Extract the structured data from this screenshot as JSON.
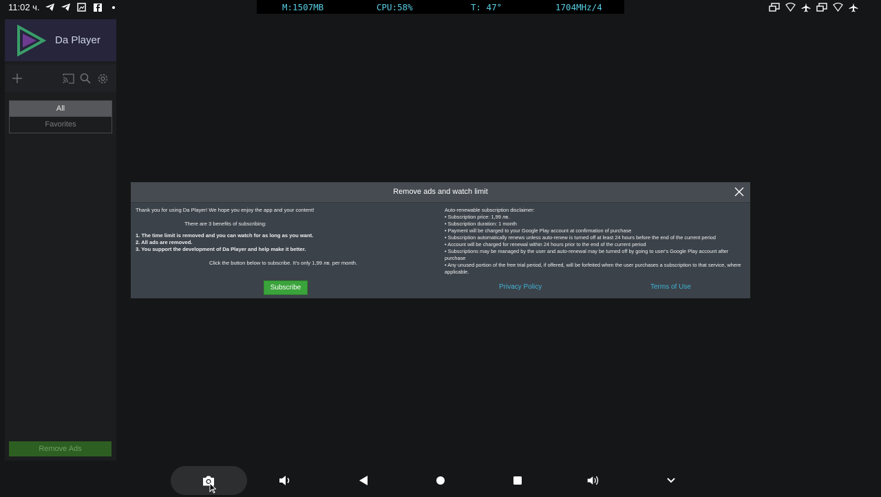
{
  "status_bar": {
    "time": "11:02 ч.",
    "memory": "M:1507MB",
    "cpu": "CPU:58%",
    "temp": "T: 47°",
    "freq": "1704MHz/4",
    "left_icons": [
      "telegram-icon",
      "telegram-icon",
      "screenshot-icon",
      "facebook-icon",
      "dot-icon"
    ],
    "right_icons": [
      "display-icon",
      "wifi-icon",
      "airplane-icon",
      "display-icon",
      "wifi-icon",
      "airplane-icon"
    ]
  },
  "sidebar": {
    "app_name": "Da Player",
    "filters": [
      "All",
      "Favorites"
    ],
    "remove_ads": "Remove Ads",
    "toolbar_icons": [
      "add-icon",
      "cast-icon",
      "search-icon",
      "settings-icon"
    ]
  },
  "dialog": {
    "title": "Remove ads and watch limit",
    "intro": "Thank you for using Da Player! We hope you enjoy the app and your content!",
    "benefits_title": "There are 3 benefits of subscribing:",
    "benefits": [
      "1. The time limit is removed and you can watch for as long as you want.",
      "2. All ads are removed.",
      "3. You support the development of Da Player and help make it better."
    ],
    "cta": "Click the button below to subscribe. It's only 1,99 лв. per month.",
    "subscribe_label": "Subscribe",
    "disclaimer_title": "Auto-renewable subscription disclaimer:",
    "disclaimer": [
      "• Subscription price: 1,99 лв.",
      "• Subscription duration: 1 month",
      "• Payment will be charged to your Google Play account at confirmation of purchase",
      "• Subscription automatically renews unless auto-renew is turned off at least 24 hours before the end of the current period",
      "• Account will be charged for renewal within 24 hours prior to the end of the current period",
      "• Subscriptions may be managed by the user and auto-renewal may be turned off by going to user's Google Play account after purchase",
      "• Any unused portion of the free trial period, if offered, will be forfeited when the user purchases a subscription to that service, where applicable."
    ],
    "privacy_label": "Privacy Policy",
    "terms_label": "Terms of Use"
  },
  "nav_bar": {
    "buttons": [
      "screenshot-icon",
      "volume-down-icon",
      "back-icon",
      "home-icon",
      "recents-icon",
      "volume-up-icon",
      "collapse-icon"
    ]
  },
  "colors": {
    "accent_green": "#3ba33b",
    "link_blue": "#3fb3d8",
    "monitor_text": "#58cfe6"
  }
}
